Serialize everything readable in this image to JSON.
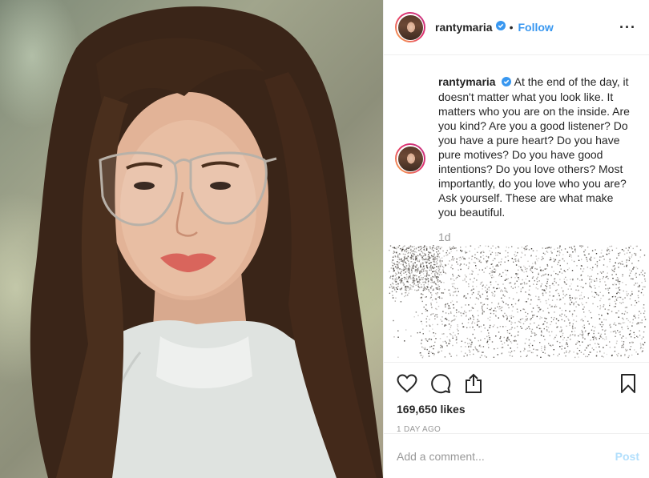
{
  "header": {
    "username": "rantymaria",
    "separator": "•",
    "follow_label": "Follow",
    "more_label": "···"
  },
  "caption": {
    "username": "rantymaria",
    "text": "At the end of the day, it doesn't matter what you look like. It matters who you are on the inside. Are you kind? Are you a good listener? Do you have a pure heart? Do you have pure motives? Do you have good intentions? Do you love others? Most importantly, do you love who you are? Ask yourself. These are what make you beautiful.",
    "age": "1d"
  },
  "actions": {
    "like_icon": "heart-icon",
    "comment_icon": "comment-icon",
    "share_icon": "share-icon",
    "save_icon": "bookmark-icon"
  },
  "stats": {
    "likes": "169,650 likes",
    "posted": "1 DAY AGO"
  },
  "comment_box": {
    "placeholder": "Add a comment...",
    "post_label": "Post"
  },
  "colors": {
    "accent": "#3897f0",
    "verified": "#3897f0",
    "post_disabled": "#b2dffc",
    "muted": "#999999"
  }
}
